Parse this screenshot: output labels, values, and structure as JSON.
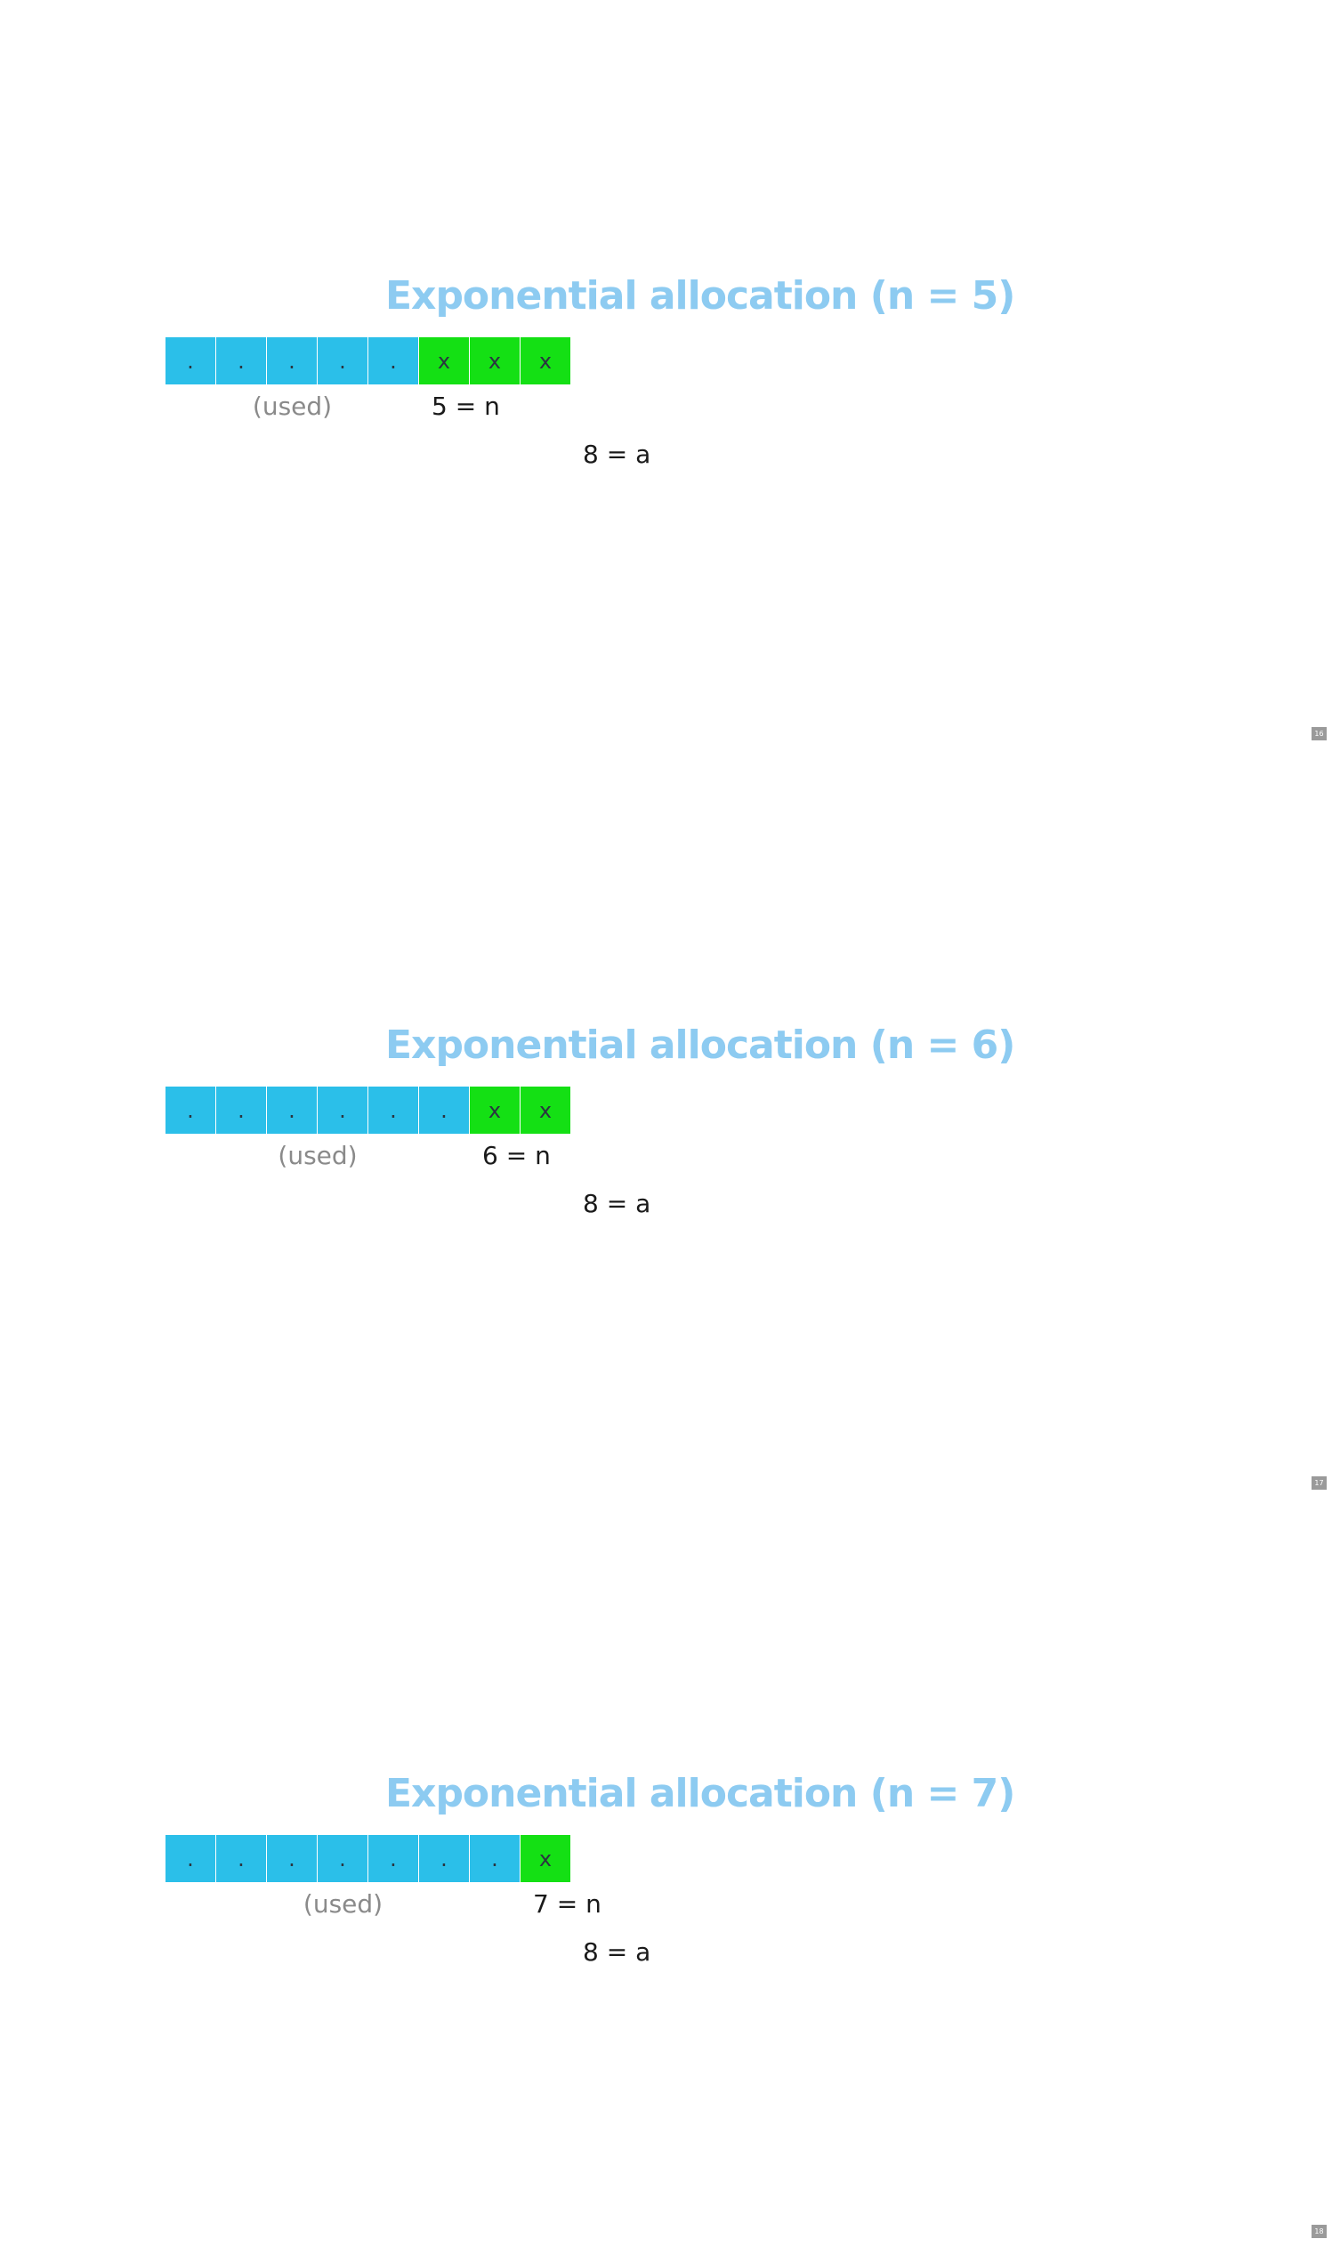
{
  "colors": {
    "used": "#2bbfe9",
    "free": "#14e014",
    "title": "#8dcbf1",
    "page_badge": "#9a9a9a"
  },
  "slides": [
    {
      "title": "Exponential allocation (n = 5)",
      "cells": [
        ".",
        ".",
        ".",
        ".",
        ".",
        "x",
        "x",
        "x"
      ],
      "used_count": 5,
      "used_label": "(used)",
      "n_label": "5 = n",
      "a_label": "8 = a",
      "page": "16"
    },
    {
      "title": "Exponential allocation (n = 6)",
      "cells": [
        ".",
        ".",
        ".",
        ".",
        ".",
        ".",
        "x",
        "x"
      ],
      "used_count": 6,
      "used_label": "(used)",
      "n_label": "6 = n",
      "a_label": "8 = a",
      "page": "17"
    },
    {
      "title": "Exponential allocation (n = 7)",
      "cells": [
        ".",
        ".",
        ".",
        ".",
        ".",
        ".",
        ".",
        "x"
      ],
      "used_count": 7,
      "used_label": "(used)",
      "n_label": "7 = n",
      "a_label": "8 = a",
      "page": "18"
    }
  ]
}
